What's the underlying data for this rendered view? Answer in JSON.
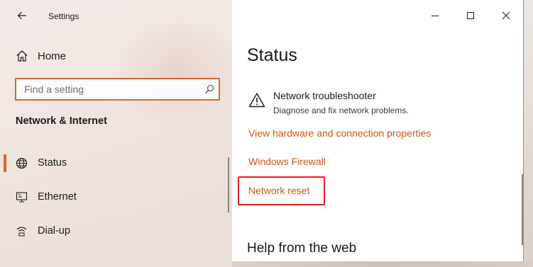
{
  "window": {
    "app_title": "Settings"
  },
  "sidebar": {
    "home_label": "Home",
    "search_placeholder": "Find a setting",
    "section_heading": "Network & Internet",
    "items": [
      {
        "label": "Status",
        "icon": "globe-icon",
        "selected": true
      },
      {
        "label": "Ethernet",
        "icon": "ethernet-icon",
        "selected": false
      },
      {
        "label": "Dial-up",
        "icon": "dialup-icon",
        "selected": false
      }
    ]
  },
  "main": {
    "page_title": "Status",
    "troubleshooter": {
      "title": "Network troubleshooter",
      "description": "Diagnose and fix network problems."
    },
    "links": {
      "hardware": "View hardware and connection properties",
      "firewall": "Windows Firewall",
      "reset": "Network reset"
    },
    "help_heading": "Help from the web"
  },
  "colors": {
    "accent": "#d86a2b",
    "link": "#c9561a",
    "highlight": "#e0201b"
  }
}
